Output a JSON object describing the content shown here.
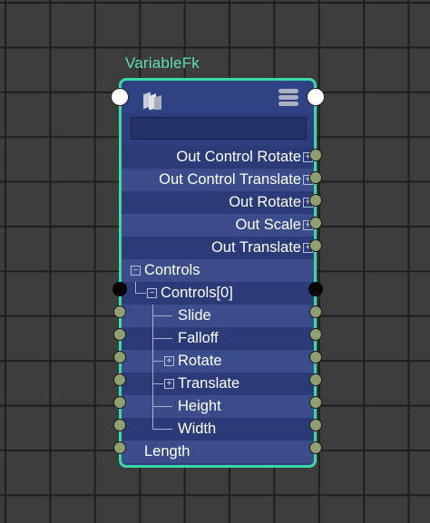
{
  "node": {
    "title": "VariableFk",
    "icons": {
      "shader": "node-shader-icon",
      "menu": "hamburger-menu-icon"
    },
    "name_field_value": "",
    "outputs": [
      {
        "label": "Out Control Rotate",
        "expandable": true
      },
      {
        "label": "Out Control Translate",
        "expandable": true
      },
      {
        "label": "Out Rotate",
        "expandable": true
      },
      {
        "label": "Out Scale",
        "expandable": true
      },
      {
        "label": "Out Translate",
        "expandable": true
      }
    ],
    "compound_rows": [
      {
        "label": "Controls",
        "expand_symbol": "−"
      },
      {
        "label": "Controls[0]",
        "expand_symbol": "−"
      },
      {
        "label": "Slide"
      },
      {
        "label": "Falloff"
      },
      {
        "label": "Rotate",
        "expand_symbol": "+"
      },
      {
        "label": "Translate",
        "expand_symbol": "+"
      },
      {
        "label": "Height"
      },
      {
        "label": "Width"
      },
      {
        "label": "Length"
      }
    ],
    "colors": {
      "border": "#3ad9a8",
      "title": "#5fe0b0",
      "body": "#2c3e7c",
      "port_plug": "#8f9f6f"
    }
  }
}
